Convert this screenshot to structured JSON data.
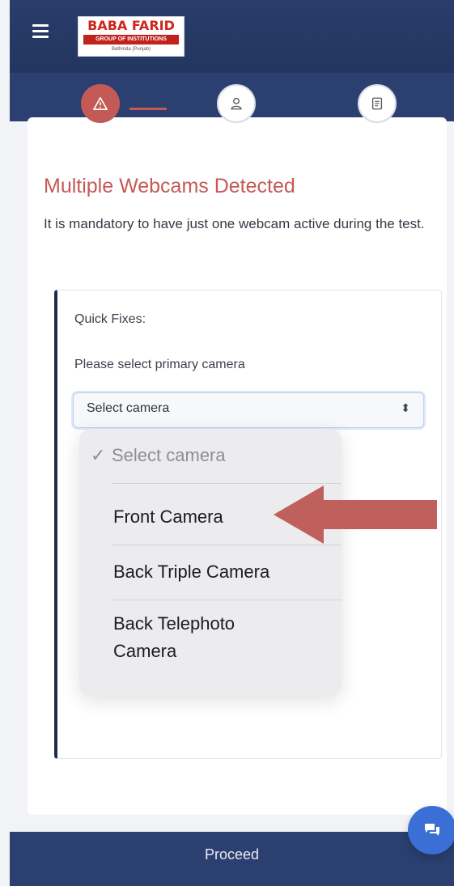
{
  "header": {
    "logo_line1": "BABA FARID",
    "logo_line2": "GROUP OF INSTITUTIONS",
    "logo_line3": "Bathinda (Punjab)",
    "menu_icon": "hamburger-icon"
  },
  "steps": [
    {
      "icon": "warning-icon",
      "active": true
    },
    {
      "icon": "user-icon",
      "active": false
    },
    {
      "icon": "document-icon",
      "active": false
    }
  ],
  "alert": {
    "title": "Multiple Webcams Detected",
    "description": "It is mandatory to have just one webcam active during the test."
  },
  "quick_fixes": {
    "heading": "Quick Fixes:",
    "select_label": "Please select primary camera",
    "select_value": "Select camera",
    "options": [
      {
        "label": "Select camera",
        "checked": true
      },
      {
        "label": "Front Camera",
        "checked": false
      },
      {
        "label": "Back Triple Camera",
        "checked": false
      },
      {
        "label": "Back Telephoto Camera",
        "checked": false
      }
    ]
  },
  "footer": {
    "proceed_label": "Proceed",
    "chat_icon": "chat-icon"
  },
  "colors": {
    "header": "#2b3f70",
    "accent": "#c45a57",
    "arrow": "#c0605c",
    "chat": "#3b6fd6"
  }
}
